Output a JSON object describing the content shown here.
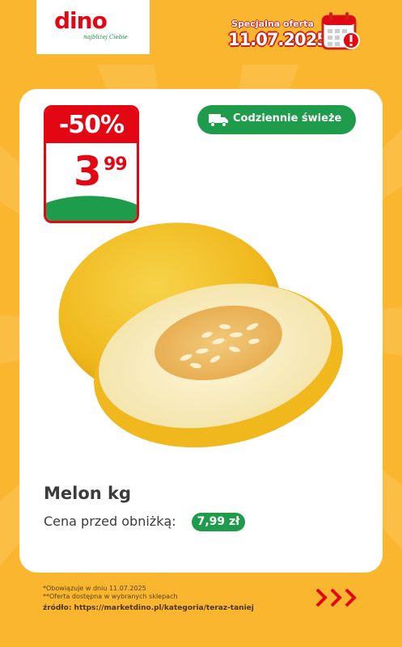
{
  "header": {
    "logo_text": "dino",
    "logo_tagline": "najbliżej Ciebie",
    "offer_title": "Specjalna oferta",
    "offer_date": "11.07.2025",
    "calendar_icon": "calendar-alert-icon"
  },
  "price_tag": {
    "discount": "-50%",
    "price_main": "3",
    "price_cents": "99"
  },
  "badge": {
    "label": "Codziennie świeże",
    "icon": "delivery-truck-icon"
  },
  "product": {
    "name": "Melon kg",
    "prev_price_label": "Cena przed obniżką:",
    "prev_price": "7,99 zł",
    "image": "yellow-melon-image"
  },
  "footer": {
    "note1": "*Obowiązuje w dniu 11.07.2025",
    "note2": "**Oferta dostępna w wybranych sklepach",
    "source": "źródło: https://marketdino.pl/kategoria/teraz-taniej",
    "arrows_icon": "triple-chevron-right-icon"
  },
  "colors": {
    "background": "#fbb62f",
    "brand_red": "#e30613",
    "brand_green": "#1e9b4b"
  }
}
